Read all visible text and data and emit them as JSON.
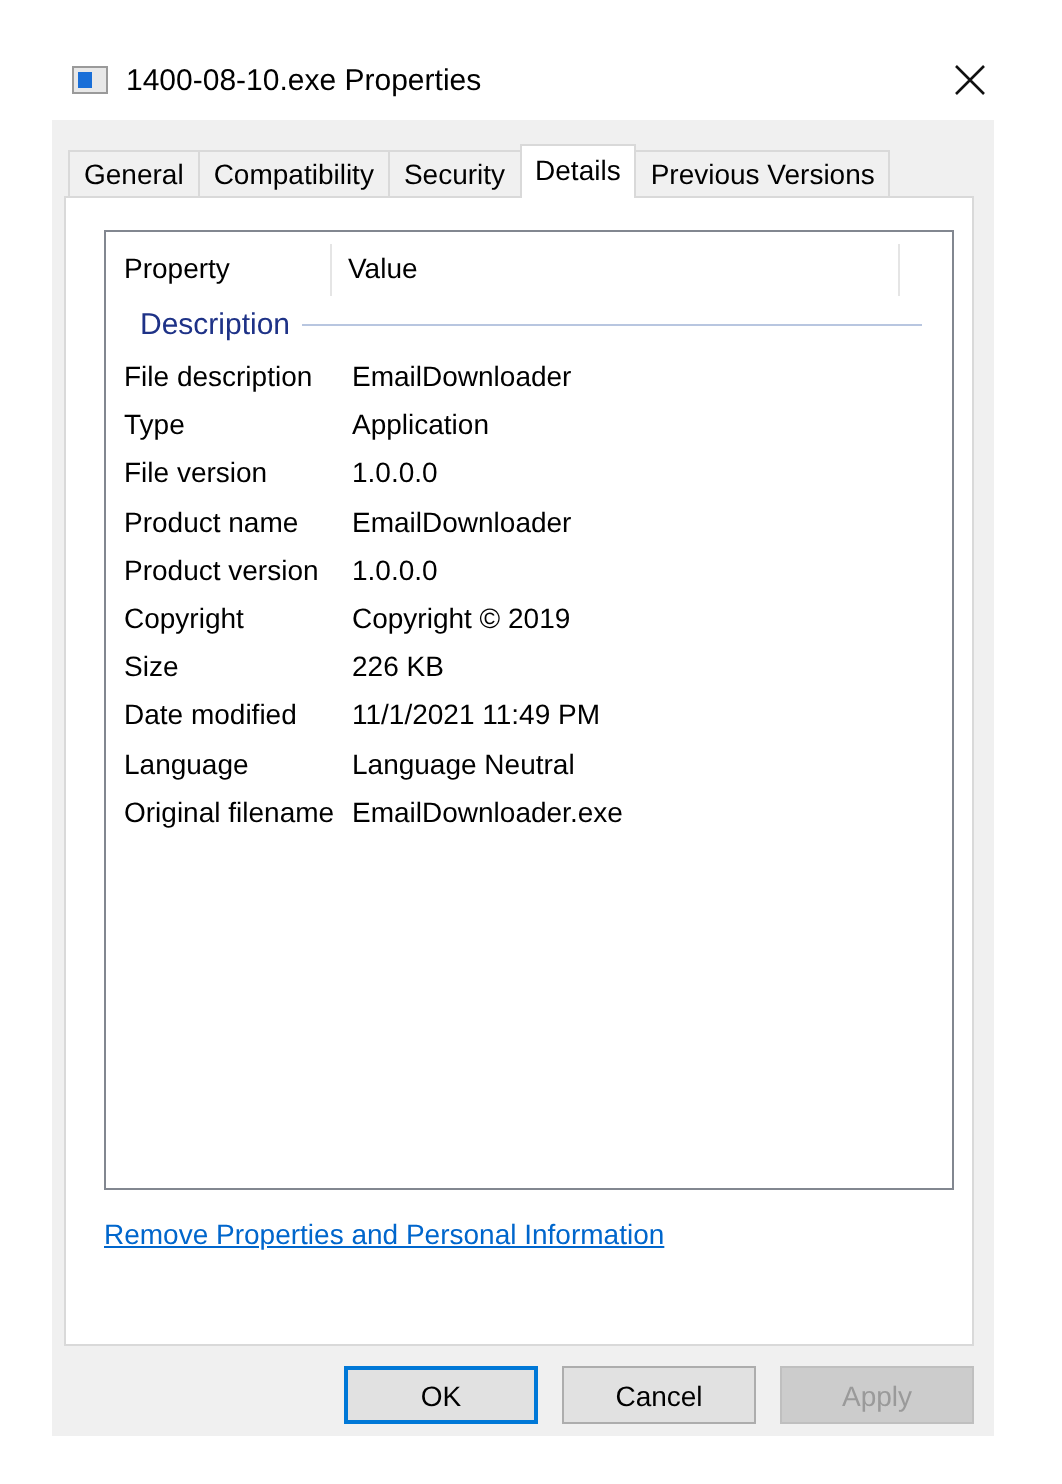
{
  "window": {
    "title": "1400-08-10.exe Properties"
  },
  "tabs": [
    {
      "label": "General",
      "selected": false
    },
    {
      "label": "Compatibility",
      "selected": false
    },
    {
      "label": "Security",
      "selected": false
    },
    {
      "label": "Details",
      "selected": true
    },
    {
      "label": "Previous Versions",
      "selected": false
    }
  ],
  "table": {
    "columns": [
      "Property",
      "Value"
    ],
    "group": "Description",
    "rows": [
      {
        "property": "File description",
        "value": "EmailDownloader"
      },
      {
        "property": "Type",
        "value": "Application"
      },
      {
        "property": "File version",
        "value": "1.0.0.0"
      },
      {
        "property": "Product name",
        "value": "EmailDownloader"
      },
      {
        "property": "Product version",
        "value": "1.0.0.0"
      },
      {
        "property": "Copyright",
        "value": "Copyright ©  2019"
      },
      {
        "property": "Size",
        "value": "226 KB"
      },
      {
        "property": "Date modified",
        "value": "11/1/2021 11:49 PM"
      },
      {
        "property": "Language",
        "value": "Language Neutral"
      },
      {
        "property": "Original filename",
        "value": "EmailDownloader.exe"
      }
    ]
  },
  "link": "Remove Properties and Personal Information",
  "buttons": [
    {
      "label": "OK",
      "default": true,
      "disabled": false
    },
    {
      "label": "Cancel",
      "default": false,
      "disabled": false
    },
    {
      "label": "Apply",
      "default": false,
      "disabled": true
    }
  ]
}
